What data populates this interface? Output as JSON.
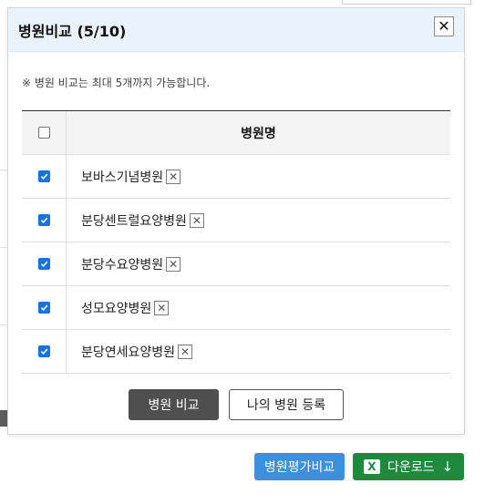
{
  "modal": {
    "title": "병원비교 (5/10)",
    "close_glyph": "✕",
    "notice": "※ 병원 비교는 최대 5개까지 가능합니다."
  },
  "table": {
    "header": "병원명",
    "rows": [
      {
        "name": "보바스기념병원",
        "checked": true
      },
      {
        "name": "분당센트럴요양병원",
        "checked": true
      },
      {
        "name": "분당수요양병원",
        "checked": true
      },
      {
        "name": "성모요양병원",
        "checked": true
      },
      {
        "name": "분당연세요양병원",
        "checked": true
      }
    ]
  },
  "buttons": {
    "compare": "병원 비교",
    "register": "나의 병원 등록"
  },
  "background": {
    "eval_compare": "병원평가비교",
    "download": "다운로드",
    "download_arrow": "↓",
    "excel_icon": "X"
  },
  "colors": {
    "header_bg": "#eaf2fc",
    "checkbox": "#1672e4",
    "primary_button": "#4f4f4f",
    "eval_button": "#3d8fe0",
    "download_button": "#1f8a3e"
  }
}
